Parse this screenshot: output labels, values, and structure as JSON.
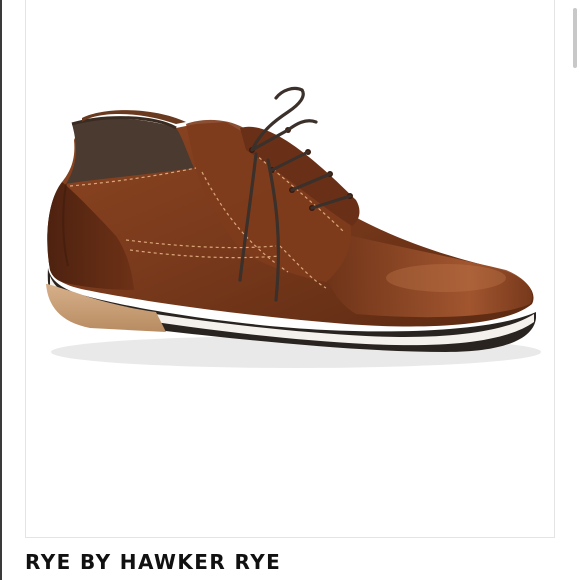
{
  "product": {
    "caption": "RYE BY HAWKER RYE",
    "photo_subject": "brown leather lace-up chukka shoe"
  },
  "colors": {
    "leather": "#7a3a1c",
    "leather_highlight": "#a85a32",
    "collar_fabric": "#4a3a30",
    "midsole": "#c9a07a",
    "outsole_stripe": "#f4f1ec",
    "caption_text": "#111111"
  }
}
